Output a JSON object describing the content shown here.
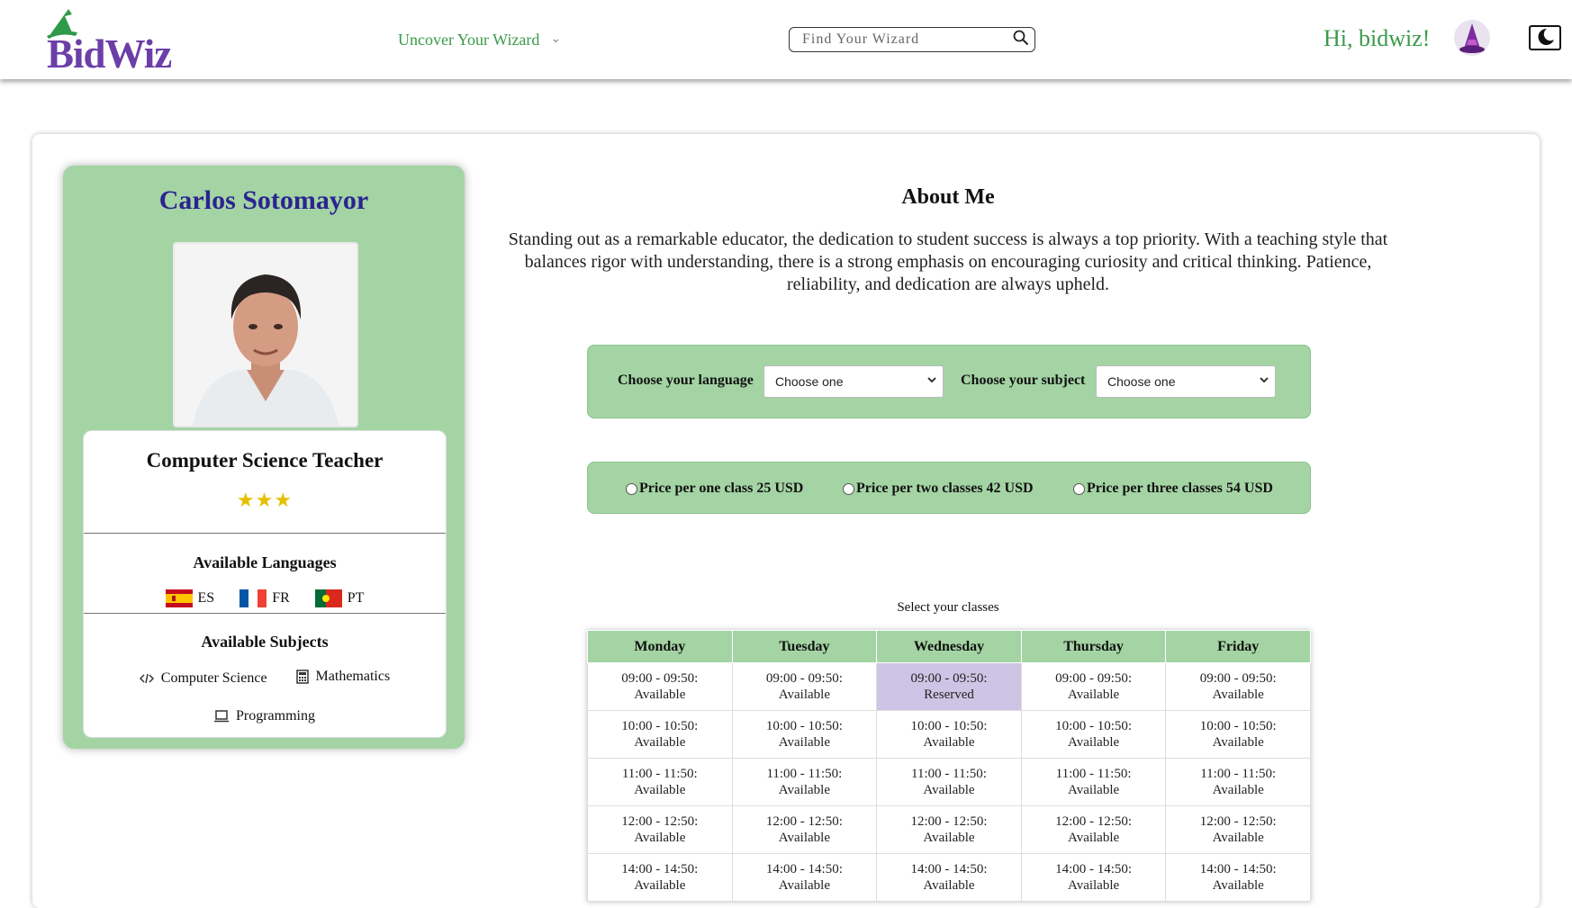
{
  "header": {
    "logo_text": "BidWiz",
    "nav_uncover": "Uncover Your Wizard",
    "search_placeholder": "Find Your Wizard",
    "greeting": "Hi, bidwiz!"
  },
  "profile": {
    "name": "Carlos Sotomayor",
    "title": "Computer Science Teacher",
    "stars": "★★★",
    "rating": 3,
    "languages_title": "Available Languages",
    "languages": [
      {
        "code": "ES"
      },
      {
        "code": "FR"
      },
      {
        "code": "PT"
      }
    ],
    "subjects_title": "Available Subjects",
    "subjects": [
      {
        "label": "Computer Science",
        "icon": "code-icon"
      },
      {
        "label": "Mathematics",
        "icon": "calculator-icon"
      },
      {
        "label": "Programming",
        "icon": "laptop-icon"
      }
    ]
  },
  "about": {
    "title": "About Me",
    "text": "Standing out as a remarkable educator, the dedication to student success is always a top priority. With a teaching style that balances rigor with understanding, there is a strong emphasis on encouraging curiosity and critical thinking. Patience, reliability, and dedication are always upheld."
  },
  "selectors": {
    "language_label": "Choose your language",
    "language_value": "Choose one",
    "subject_label": "Choose your subject",
    "subject_value": "Choose one"
  },
  "prices": [
    "Price per one class 25 USD",
    "Price per two classes 42 USD",
    "Price per three classes 54 USD"
  ],
  "schedule": {
    "caption": "Select your classes",
    "days": [
      "Monday",
      "Tuesday",
      "Wednesday",
      "Thursday",
      "Friday"
    ],
    "rows": [
      {
        "time": "09:00 - 09:50:",
        "status": [
          "Available",
          "Available",
          "Reserved",
          "Available",
          "Available"
        ]
      },
      {
        "time": "10:00 - 10:50:",
        "status": [
          "Available",
          "Available",
          "Available",
          "Available",
          "Available"
        ]
      },
      {
        "time": "11:00 - 11:50:",
        "status": [
          "Available",
          "Available",
          "Available",
          "Available",
          "Available"
        ]
      },
      {
        "time": "12:00 - 12:50:",
        "status": [
          "Available",
          "Available",
          "Available",
          "Available",
          "Available"
        ]
      },
      {
        "time": "14:00 - 14:50:",
        "status": [
          "Available",
          "Available",
          "Available",
          "Available",
          "Available"
        ]
      }
    ]
  },
  "colors": {
    "brand_purple": "#6b3fa8",
    "brand_green": "#3a9a4a",
    "panel_green": "#a4d4a4",
    "reserved": "#cec5e6",
    "name_blue": "#2b2490"
  }
}
